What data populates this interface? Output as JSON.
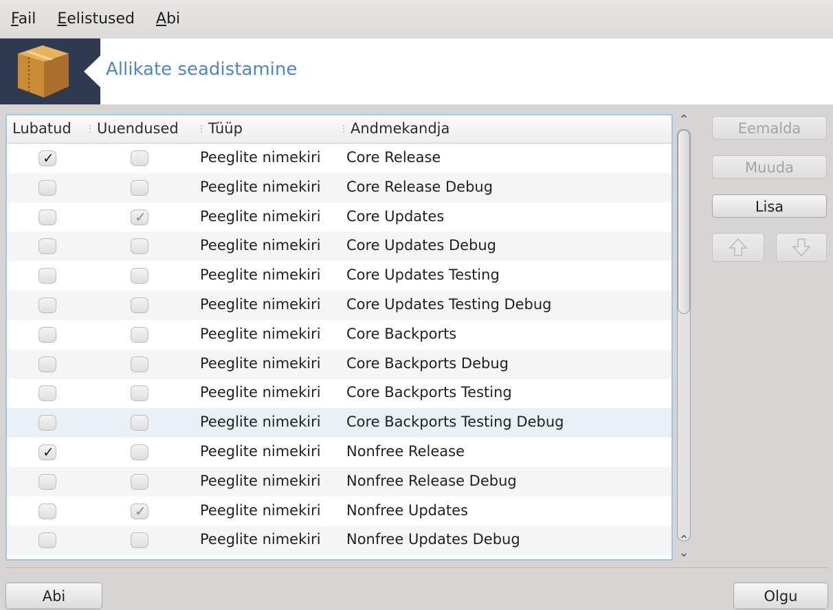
{
  "menu": [
    {
      "accel": "F",
      "rest": "ail"
    },
    {
      "accel": "E",
      "rest": "elistused"
    },
    {
      "accel": "A",
      "rest": "bi"
    }
  ],
  "banner": {
    "title": "Allikate seadistamine",
    "icon": "package-box-icon"
  },
  "table": {
    "headers": {
      "enabled": "Lubatud",
      "updates": "Uuendused",
      "type": "Tüüp",
      "medium": "Andmekandja"
    },
    "rows": [
      {
        "enabled": true,
        "updates": false,
        "updates_grey": false,
        "type": "Peeglite nimekiri",
        "medium": "Core Release"
      },
      {
        "enabled": false,
        "updates": false,
        "updates_grey": false,
        "type": "Peeglite nimekiri",
        "medium": "Core Release Debug"
      },
      {
        "enabled": false,
        "updates": true,
        "updates_grey": true,
        "type": "Peeglite nimekiri",
        "medium": "Core Updates"
      },
      {
        "enabled": false,
        "updates": false,
        "updates_grey": false,
        "type": "Peeglite nimekiri",
        "medium": "Core Updates Debug"
      },
      {
        "enabled": false,
        "updates": false,
        "updates_grey": false,
        "type": "Peeglite nimekiri",
        "medium": "Core Updates Testing"
      },
      {
        "enabled": false,
        "updates": false,
        "updates_grey": false,
        "type": "Peeglite nimekiri",
        "medium": "Core Updates Testing Debug"
      },
      {
        "enabled": false,
        "updates": false,
        "updates_grey": false,
        "type": "Peeglite nimekiri",
        "medium": "Core Backports"
      },
      {
        "enabled": false,
        "updates": false,
        "updates_grey": false,
        "type": "Peeglite nimekiri",
        "medium": "Core Backports Debug"
      },
      {
        "enabled": false,
        "updates": false,
        "updates_grey": false,
        "type": "Peeglite nimekiri",
        "medium": "Core Backports Testing"
      },
      {
        "enabled": false,
        "updates": false,
        "updates_grey": false,
        "type": "Peeglite nimekiri",
        "medium": "Core Backports Testing Debug"
      },
      {
        "enabled": true,
        "updates": false,
        "updates_grey": false,
        "type": "Peeglite nimekiri",
        "medium": "Nonfree Release"
      },
      {
        "enabled": false,
        "updates": false,
        "updates_grey": false,
        "type": "Peeglite nimekiri",
        "medium": "Nonfree Release Debug"
      },
      {
        "enabled": false,
        "updates": true,
        "updates_grey": true,
        "type": "Peeglite nimekiri",
        "medium": "Nonfree Updates"
      },
      {
        "enabled": false,
        "updates": false,
        "updates_grey": false,
        "type": "Peeglite nimekiri",
        "medium": "Nonfree Updates Debug"
      }
    ],
    "hover_row": 9
  },
  "side_buttons": {
    "remove": "Eemalda",
    "edit": "Muuda",
    "add": "Lisa",
    "up_icon": "arrow-up-icon",
    "down_icon": "arrow-down-icon"
  },
  "bottom": {
    "help": "Abi",
    "ok": "Olgu"
  },
  "colors": {
    "title": "#4e86c7",
    "logo_bg": "#2d3a4f",
    "frame_border": "#9bc7ea"
  }
}
